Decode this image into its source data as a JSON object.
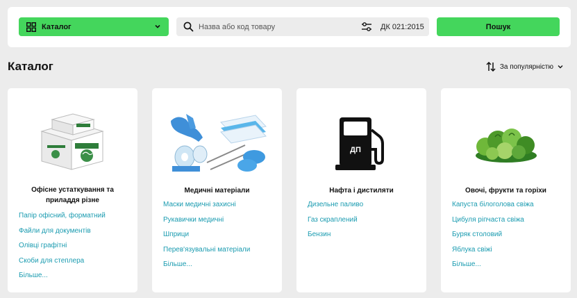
{
  "header": {
    "catalog_label": "Каталог",
    "search_placeholder": "Назва або код товару",
    "classifier_label": "ДК 021:2015",
    "search_button": "Пошук"
  },
  "main": {
    "title": "Каталог",
    "sort_label": "За популярністю"
  },
  "categories": [
    {
      "title": "Офісне устаткування та приладдя різне",
      "image": "paper-boxes",
      "items": [
        "Папір офісний, форматний",
        "Файли для документів",
        "Олівці графітні",
        "Скоби для степлера",
        "Більше..."
      ]
    },
    {
      "title": "Медичні матеріали",
      "image": "medical-supplies",
      "items": [
        "Маски медичні захисні",
        "Рукавички медичні",
        "Шприци",
        "Перев'язувальні матеріали",
        "Більше..."
      ]
    },
    {
      "title": "Нафта і дистиляти",
      "image": "fuel-pump",
      "image_text": "ДП",
      "items": [
        "Дизельне паливо",
        "Газ скраплений",
        "Бензин"
      ]
    },
    {
      "title": "Овочі, фрукти та горіхи",
      "image": "vegetables",
      "items": [
        "Капуста білоголова свіжа",
        "Цибуля ріпчаста свіжа",
        "Буряк столовий",
        "Яблука свіжі",
        "Більше..."
      ]
    }
  ],
  "colors": {
    "accent": "#44d65c",
    "link": "#1a9bb0",
    "background": "#ececec"
  }
}
